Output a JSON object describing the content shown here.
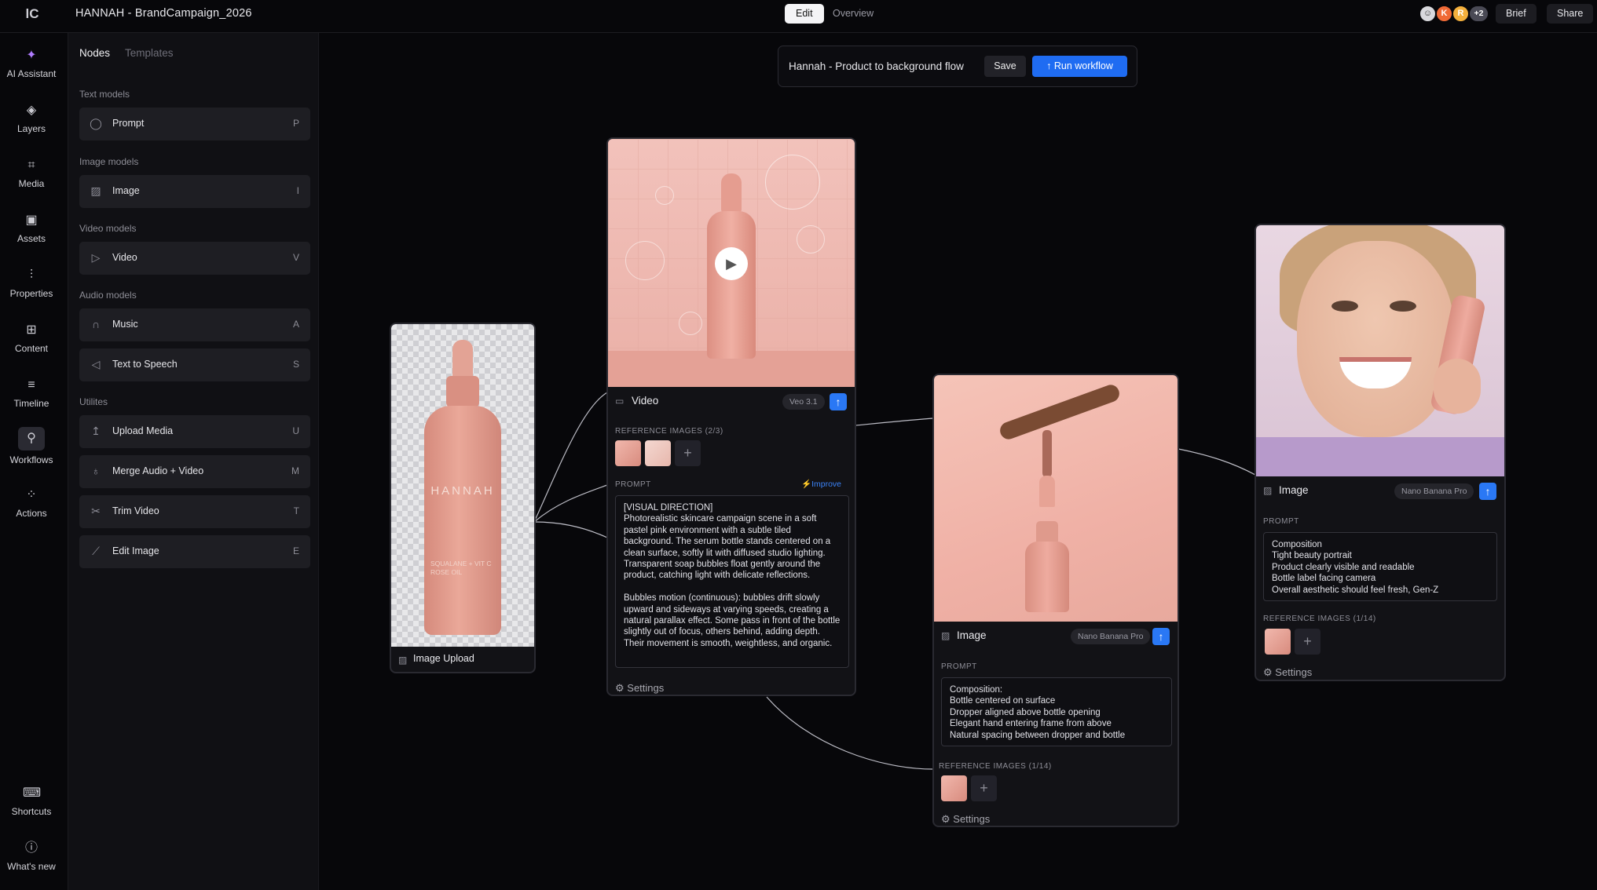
{
  "app": {
    "logo_text": "lC",
    "project_title": "HANNAH - BrandCampaign_2026"
  },
  "top_tabs": {
    "edit": "Edit",
    "overview": "Overview"
  },
  "collaborators": {
    "avatars": [
      "",
      "K",
      "R"
    ],
    "more": "+2",
    "colors": [
      "#d9d9dd",
      "#f06a36",
      "#f4b03c",
      "#5a5a66"
    ]
  },
  "top_buttons": {
    "brief": "Brief",
    "share": "Share"
  },
  "sidebar": [
    {
      "label": "AI Assistant",
      "icon": "sparkle-icon"
    },
    {
      "label": "Layers",
      "icon": "layers-icon"
    },
    {
      "label": "Media",
      "icon": "media-icon"
    },
    {
      "label": "Assets",
      "icon": "assets-icon"
    },
    {
      "label": "Properties",
      "icon": "sliders-icon"
    },
    {
      "label": "Content",
      "icon": "content-icon"
    },
    {
      "label": "Timeline",
      "icon": "timeline-icon"
    },
    {
      "label": "Workflows",
      "icon": "workflows-icon"
    },
    {
      "label": "Actions",
      "icon": "actions-icon"
    },
    {
      "label": "Shortcuts",
      "icon": "keyboard-icon"
    },
    {
      "label": "What's new",
      "icon": "help-icon"
    }
  ],
  "panel": {
    "tabs": {
      "nodes": "Nodes",
      "templates": "Templates"
    },
    "sections": {
      "text": "Text models",
      "image": "Image models",
      "video": "Video models",
      "audio": "Audio models",
      "utilities": "Utilites"
    },
    "items": [
      {
        "label": "Prompt",
        "key": "P"
      },
      {
        "label": "Image",
        "key": "I"
      },
      {
        "label": "Video",
        "key": "V"
      },
      {
        "label": "Music",
        "key": "A"
      },
      {
        "label": "Text to Speech",
        "key": "S"
      },
      {
        "label": "Upload Media",
        "key": "U"
      },
      {
        "label": "Merge Audio + Video",
        "key": "M"
      },
      {
        "label": "Trim Video",
        "key": "T"
      },
      {
        "label": "Edit Image",
        "key": "E"
      }
    ]
  },
  "workflow": {
    "title": "Hannah - Product to background flow",
    "save": "Save",
    "run": "Run workflow"
  },
  "upload_node": {
    "title": "Image Upload",
    "bottle_text": "HANNAH",
    "bottle_sub": "SQUALANE + VIT C ROSE OIL"
  },
  "video_node": {
    "title": "Video",
    "model": "Veo 3.1",
    "ref_label": "REFERENCE IMAGES (2/3)",
    "prompt_label": "PROMPT",
    "improve": "Improve",
    "prompt": "[VISUAL DIRECTION]\nPhotorealistic skincare campaign scene in a soft pastel pink environment with a subtle tiled background. The serum bottle stands centered on a clean surface, softly lit with diffused studio lighting. Transparent soap bubbles float gently around the product, catching light with delicate reflections.\n\nBubbles motion (continuous): bubbles drift slowly upward and sideways at varying speeds, creating a natural parallax effect. Some pass in front of the bottle slightly out of focus, others behind, adding depth. Their movement is smooth, weightless, and organic.",
    "settings": "Settings"
  },
  "image_node_1": {
    "title": "Image",
    "model": "Nano Banana Pro",
    "prompt_label": "PROMPT",
    "prompt": "Composition:\nBottle centered on surface\nDropper aligned above bottle opening\nElegant hand entering frame from above\nNatural spacing between dropper and bottle",
    "ref_label": "REFERENCE IMAGES (1/14)",
    "settings": "Settings"
  },
  "image_node_2": {
    "title": "Image",
    "model": "Nano Banana Pro",
    "prompt_label": "PROMPT",
    "prompt": "Composition\nTight beauty portrait\nProduct clearly visible and readable\nBottle label facing camera\nOverall aesthetic should feel fresh, Gen-Z",
    "ref_label": "REFERENCE IMAGES (1/14)",
    "settings": "Settings"
  }
}
